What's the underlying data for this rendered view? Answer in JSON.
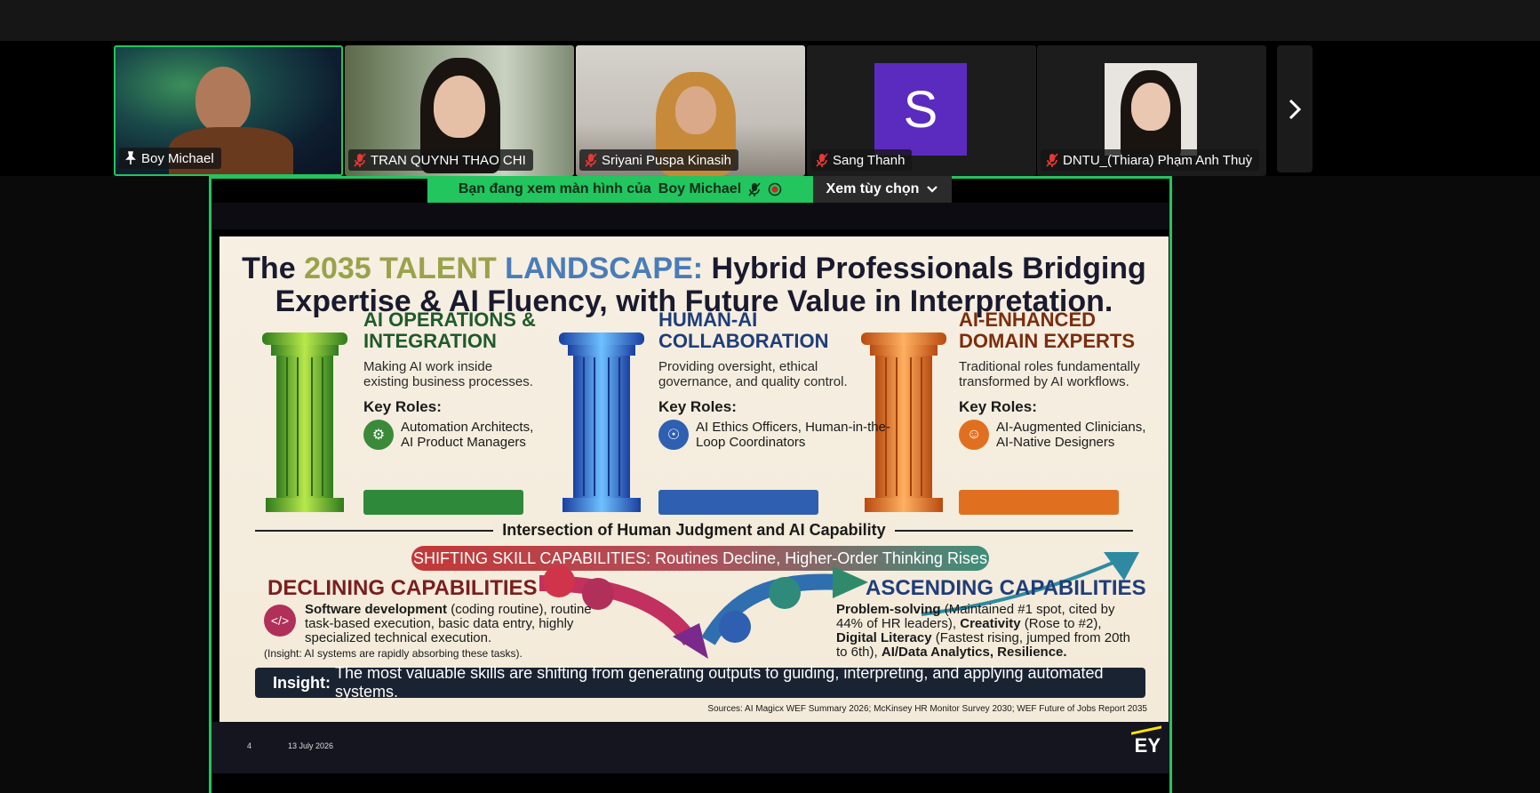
{
  "participants": [
    {
      "name": "Boy Michael",
      "mic": "pinned"
    },
    {
      "name": "TRAN QUYNH THAO CHI",
      "mic": "muted"
    },
    {
      "name": "Sriyani Puspa Kinasih",
      "mic": "muted"
    },
    {
      "name": "Sang Thanh",
      "mic": "muted",
      "avatar_letter": "S",
      "avatar_color": "#5b2bbf"
    },
    {
      "name": "DNTU_(Thiara) Phạm Anh Thuỳ",
      "mic": "muted"
    }
  ],
  "share_banner": {
    "text": "Bạn đang xem màn hình của",
    "presenter": "Boy Michael"
  },
  "view_options": {
    "label": "Xem tùy chọn"
  },
  "slide": {
    "title_prefix": "The",
    "title_part1": "2035 TALENT",
    "title_part2": "LANDSCAPE:",
    "title_rest_line1": "Hybrid Professionals Bridging",
    "title_line2": "Expertise & AI Fluency, with Future Value in Interpretation.",
    "columns": [
      {
        "heading": "AI OPERATIONS & INTEGRATION",
        "heading_color": "#1f5a2a",
        "desc": "Making AI work inside existing business processes.",
        "key_roles_label": "Key Roles:",
        "roles": "Automation Architects, AI Product Managers",
        "icon": "gear-people-icon",
        "accent": "#3a8a3a"
      },
      {
        "heading": "HUMAN-AI COLLABORATION",
        "heading_color": "#1f3d7a",
        "desc": "Providing oversight, ethical governance, and quality control.",
        "key_roles_label": "Key Roles:",
        "roles": "AI Ethics Officers, Human-in-the-Loop Coordinators",
        "icon": "brain-icon",
        "accent": "#2f5fb0"
      },
      {
        "heading": "AI-ENHANCED DOMAIN EXPERTS",
        "heading_color": "#7a2e0e",
        "desc": "Traditional roles fundamentally transformed by AI workflows.",
        "key_roles_label": "Key Roles:",
        "roles": "AI-Augmented Clinicians, AI-Native Designers",
        "icon": "person-icon",
        "accent": "#e07020"
      }
    ],
    "intersection": "Intersection of Human Judgment and AI Capability",
    "shifting": "SHIFTING SKILL CAPABILITIES: Routines Decline, Higher-Order Thinking Rises",
    "declining": {
      "heading": "DECLINING CAPABILITIES",
      "bold": "Software development",
      "body": " (coding routine), routine task-based execution, basic data entry, highly specialized technical execution.",
      "insight": "(Insight: AI systems are rapidly absorbing these tasks)."
    },
    "ascending": {
      "heading": "ASCENDING CAPABILITIES",
      "b1": "Problem-solving",
      "t1": " (Maintained #1 spot, cited by 44% of HR leaders), ",
      "b2": "Creativity",
      "t2": " (Rose to #2), ",
      "b3": "Digital Literacy",
      "t3": " (Fastest rising, jumped from 20th to 6th), ",
      "b4": "AI/Data Analytics, Resilience."
    },
    "insight_label": "Insight:",
    "insight_text": "The most valuable skills are shifting from generating outputs to guiding, interpreting, and applying automated systems.",
    "sources": "Sources: AI Magicx WEF Summary 2026; McKinsey HR Monitor Survey 2030; WEF Future of Jobs Report 2035",
    "page_number": "4",
    "date": "13 July 2026",
    "logo": "EY"
  }
}
